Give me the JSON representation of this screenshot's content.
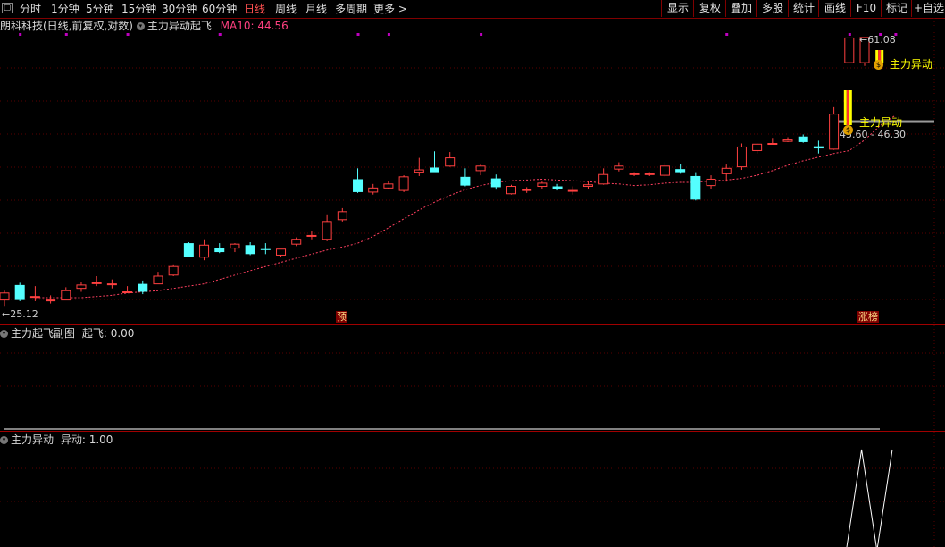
{
  "toolbar": {
    "periods": [
      "分时",
      "1分钟",
      "5分钟",
      "15分钟",
      "30分钟",
      "60分钟",
      "日线",
      "周线",
      "月线",
      "多周期",
      "更多"
    ],
    "active_period": "日线",
    "more_arrow": ">",
    "buttons": [
      "显示",
      "复权",
      "叠加",
      "多股",
      "统计",
      "画线",
      "F10",
      "标记",
      "+自选"
    ]
  },
  "main_chart": {
    "stock_info": "朗科科技(日线,前复权,对数)",
    "indicator_name": "主力异动起飞",
    "ma_label": "MA10: 44.56",
    "high_label": "61.08",
    "low_label": "25.12",
    "range_label": "45.60 - 46.30",
    "signal_label_1": "主力异动",
    "signal_label_2": "主力异动",
    "marker_yu": "预",
    "marker_zb": "涨榜",
    "colors": {
      "up": "#ff4040",
      "down": "#54ffff",
      "ma": "#ff4060",
      "dot": "#c000c0",
      "signal": "#ffff00"
    }
  },
  "sub_chart_1": {
    "title": "主力起飞副图",
    "value_label": "起飞: 0.00"
  },
  "sub_chart_2": {
    "title": "主力异动",
    "value_label": "异动: 1.00"
  },
  "chart_data": {
    "type": "candlestick",
    "candles": [
      {
        "o": 25.6,
        "h": 26.4,
        "l": 25.1,
        "c": 26.2
      },
      {
        "o": 26.9,
        "h": 27.1,
        "l": 25.5,
        "c": 25.6
      },
      {
        "o": 25.9,
        "h": 26.8,
        "l": 25.5,
        "c": 25.9
      },
      {
        "o": 25.6,
        "h": 26.0,
        "l": 25.3,
        "c": 25.6
      },
      {
        "o": 25.6,
        "h": 26.7,
        "l": 25.6,
        "c": 26.4
      },
      {
        "o": 26.6,
        "h": 27.2,
        "l": 26.3,
        "c": 26.9
      },
      {
        "o": 27.1,
        "h": 27.7,
        "l": 26.8,
        "c": 27.1
      },
      {
        "o": 27.0,
        "h": 27.4,
        "l": 26.6,
        "c": 27.0
      },
      {
        "o": 26.3,
        "h": 26.8,
        "l": 26.2,
        "c": 26.3
      },
      {
        "o": 27.0,
        "h": 27.3,
        "l": 26.1,
        "c": 26.3
      },
      {
        "o": 27.0,
        "h": 28.1,
        "l": 27.0,
        "c": 27.7
      },
      {
        "o": 27.8,
        "h": 28.8,
        "l": 27.7,
        "c": 28.6
      },
      {
        "o": 30.9,
        "h": 31.0,
        "l": 29.6,
        "c": 29.5
      },
      {
        "o": 29.5,
        "h": 31.3,
        "l": 29.2,
        "c": 30.7
      },
      {
        "o": 30.4,
        "h": 30.9,
        "l": 29.9,
        "c": 30.0
      },
      {
        "o": 30.4,
        "h": 30.9,
        "l": 30.0,
        "c": 30.8
      },
      {
        "o": 30.7,
        "h": 31.0,
        "l": 29.7,
        "c": 29.8
      },
      {
        "o": 30.3,
        "h": 30.9,
        "l": 29.8,
        "c": 30.2
      },
      {
        "o": 29.7,
        "h": 30.3,
        "l": 29.5,
        "c": 30.3
      },
      {
        "o": 30.8,
        "h": 31.5,
        "l": 30.6,
        "c": 31.3
      },
      {
        "o": 31.7,
        "h": 32.2,
        "l": 31.3,
        "c": 31.7
      },
      {
        "o": 31.3,
        "h": 34.0,
        "l": 31.1,
        "c": 33.2
      },
      {
        "o": 33.4,
        "h": 34.7,
        "l": 33.2,
        "c": 34.3
      },
      {
        "o": 38.2,
        "h": 39.6,
        "l": 36.5,
        "c": 36.6
      },
      {
        "o": 36.6,
        "h": 37.6,
        "l": 36.3,
        "c": 37.1
      },
      {
        "o": 37.1,
        "h": 38.0,
        "l": 37.0,
        "c": 37.6
      },
      {
        "o": 36.8,
        "h": 38.7,
        "l": 36.6,
        "c": 38.5
      },
      {
        "o": 39.1,
        "h": 41.0,
        "l": 38.6,
        "c": 39.4
      },
      {
        "o": 39.7,
        "h": 41.9,
        "l": 39.5,
        "c": 39.1
      },
      {
        "o": 39.9,
        "h": 41.8,
        "l": 39.8,
        "c": 41.0
      },
      {
        "o": 38.5,
        "h": 39.6,
        "l": 37.3,
        "c": 37.4
      },
      {
        "o": 39.3,
        "h": 40.1,
        "l": 38.7,
        "c": 39.9
      },
      {
        "o": 38.3,
        "h": 38.8,
        "l": 36.9,
        "c": 37.2
      },
      {
        "o": 36.4,
        "h": 37.5,
        "l": 36.3,
        "c": 37.3
      },
      {
        "o": 36.9,
        "h": 37.2,
        "l": 36.5,
        "c": 36.9
      },
      {
        "o": 37.3,
        "h": 37.9,
        "l": 37.0,
        "c": 37.7
      },
      {
        "o": 37.3,
        "h": 37.6,
        "l": 36.8,
        "c": 37.0
      },
      {
        "o": 36.8,
        "h": 37.3,
        "l": 36.3,
        "c": 36.8
      },
      {
        "o": 37.3,
        "h": 37.9,
        "l": 37.0,
        "c": 37.5
      },
      {
        "o": 37.6,
        "h": 39.6,
        "l": 37.5,
        "c": 38.8
      },
      {
        "o": 39.5,
        "h": 40.4,
        "l": 39.2,
        "c": 39.9
      },
      {
        "o": 38.9,
        "h": 39.1,
        "l": 38.6,
        "c": 38.9
      },
      {
        "o": 38.9,
        "h": 39.1,
        "l": 38.6,
        "c": 38.9
      },
      {
        "o": 38.7,
        "h": 40.4,
        "l": 38.5,
        "c": 39.9
      },
      {
        "o": 39.5,
        "h": 40.2,
        "l": 38.9,
        "c": 39.1
      },
      {
        "o": 38.6,
        "h": 39.1,
        "l": 35.6,
        "c": 35.7
      },
      {
        "o": 37.4,
        "h": 38.7,
        "l": 37.0,
        "c": 38.2
      },
      {
        "o": 38.9,
        "h": 40.1,
        "l": 37.9,
        "c": 39.6
      },
      {
        "o": 39.8,
        "h": 43.0,
        "l": 39.4,
        "c": 42.5
      },
      {
        "o": 42.0,
        "h": 43.0,
        "l": 41.6,
        "c": 42.9
      },
      {
        "o": 43.0,
        "h": 43.8,
        "l": 42.9,
        "c": 43.0
      },
      {
        "o": 43.3,
        "h": 43.9,
        "l": 43.2,
        "c": 43.5
      },
      {
        "o": 44.0,
        "h": 44.3,
        "l": 43.1,
        "c": 43.2
      },
      {
        "o": 42.6,
        "h": 43.4,
        "l": 41.6,
        "c": 42.3
      },
      {
        "o": 42.2,
        "h": 48.5,
        "l": 42.1,
        "c": 47.4
      },
      {
        "o": 56.2,
        "h": 60.1,
        "l": 56.2,
        "c": 61.0
      },
      {
        "o": 56.2,
        "h": 61.1,
        "l": 55.6,
        "c": 61.1
      }
    ],
    "ma10": [
      25.8,
      25.8,
      25.8,
      25.8,
      25.9,
      26.0,
      26.2,
      26.3,
      26.4,
      26.6,
      26.8,
      27.0,
      27.4,
      27.8,
      28.2,
      28.6,
      29.0,
      29.4,
      29.8,
      30.2,
      30.5,
      30.9,
      31.6,
      32.5,
      33.5,
      34.5,
      35.4,
      36.2,
      36.9,
      37.4,
      37.8,
      38.0,
      38.1,
      38.2,
      38.1,
      38.0,
      37.9,
      37.7,
      37.6,
      37.4,
      37.5,
      37.7,
      37.8,
      37.8,
      38.0,
      38.1,
      38.3,
      38.7,
      39.3,
      40.0,
      40.6,
      41.1,
      41.6,
      42.0,
      43.5,
      45.6,
      47.2
    ],
    "ymin": 25.12,
    "ymax": 61.08,
    "scale": "log",
    "purple_dot_indices": [
      1,
      4,
      8,
      14,
      23,
      25,
      31,
      47,
      55,
      57,
      58
    ],
    "signal_bar_indices": [
      55,
      56
    ],
    "ind2_values": [
      0,
      0,
      0,
      0,
      0,
      0,
      0,
      0,
      0,
      0,
      0,
      0,
      0,
      0,
      0,
      0,
      0,
      0,
      0,
      0,
      0,
      0,
      0,
      0,
      0,
      0,
      0,
      0,
      0,
      0,
      0,
      0,
      0,
      0,
      0,
      0,
      0,
      0,
      0,
      0,
      0,
      0,
      0,
      0,
      0,
      0,
      0,
      0,
      0,
      0,
      0,
      0,
      0,
      0,
      0,
      1,
      0,
      1
    ]
  }
}
